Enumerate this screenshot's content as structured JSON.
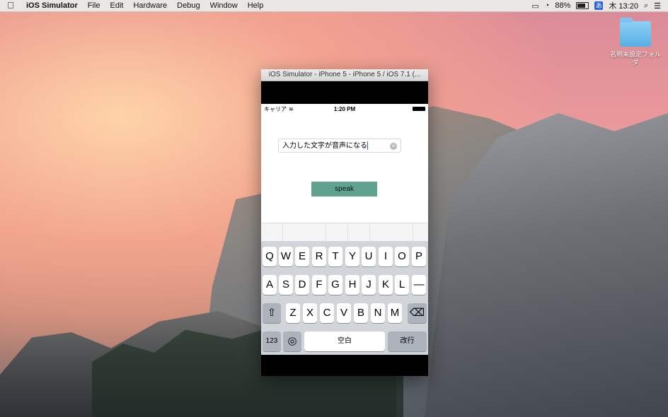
{
  "menubar": {
    "apple_icon": "apple-logo",
    "app_name": "iOS Simulator",
    "menus": [
      "File",
      "Edit",
      "Hardware",
      "Debug",
      "Window",
      "Help"
    ],
    "battery_percent": "88%",
    "ime_label": "あ",
    "clock": "木 13:20"
  },
  "desktop": {
    "folder_label": "名称未設定フォルダ"
  },
  "simulator": {
    "window_title": "iOS Simulator - iPhone 5 - iPhone 5 / iOS 7.1 (...",
    "status": {
      "carrier": "キャリア",
      "time": "1:20 PM"
    },
    "text_field": {
      "value": "入力した文字が音声になる"
    },
    "speak_button": "speak",
    "keyboard": {
      "row1": [
        "Q",
        "W",
        "E",
        "R",
        "T",
        "Y",
        "U",
        "I",
        "O",
        "P"
      ],
      "row2": [
        "A",
        "S",
        "D",
        "F",
        "G",
        "H",
        "J",
        "K",
        "L",
        "—"
      ],
      "row3": [
        "Z",
        "X",
        "C",
        "V",
        "B",
        "N",
        "M"
      ],
      "numbers_key": "123",
      "space_key": "空白",
      "return_key": "改行"
    }
  }
}
